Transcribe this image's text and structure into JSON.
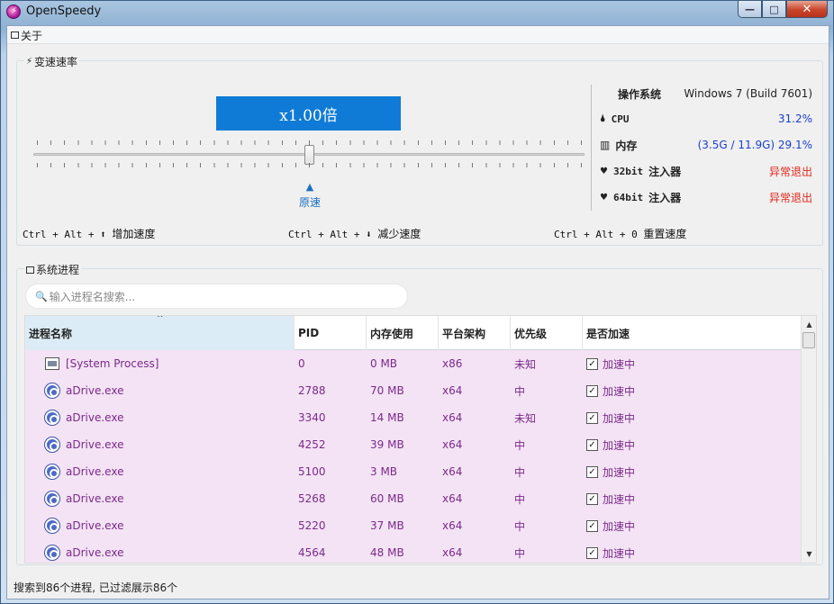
{
  "window": {
    "title": "OpenSpeedy",
    "app_icon_glyph": "⚡",
    "controls": {
      "minimize": "—",
      "maximize": "□",
      "close": "✕"
    }
  },
  "menu": {
    "about": "关于"
  },
  "speed": {
    "group_title": "变速速率",
    "group_icon": "⚡",
    "display": "x1.00倍",
    "multiplier": 1.0,
    "origin_arrow": "▲",
    "origin_label": "原速",
    "hotkeys": {
      "increase_keys": "Ctrl + Alt + ⬆",
      "increase_label": "增加速度",
      "decrease_keys": "Ctrl + Alt + ⬇",
      "decrease_label": "减少速度",
      "reset_keys": "Ctrl + Alt + 0",
      "reset_label": "重置速度"
    }
  },
  "system": {
    "os_label": "操作系统",
    "os_value": "Windows 7 (Build 7601)",
    "cpu_icon": "🌢",
    "cpu_label": "CPU",
    "cpu_value": "31.2%",
    "mem_icon": "▥",
    "mem_label": "内存",
    "mem_value": "(3.5G / 11.9G) 29.1%",
    "inj32_icon": "♥",
    "inj32_label_a": "32bit",
    "inj32_label_b": "注入器",
    "inj32_value": "异常退出",
    "inj64_icon": "♥",
    "inj64_label_a": "64bit",
    "inj64_label_b": "注入器",
    "inj64_value": "异常退出",
    "colors": {
      "value_blue": "#1a3fcc",
      "error_red": "#e0281b"
    }
  },
  "processes": {
    "group_title": "系统进程",
    "search_icon": "🔍",
    "search_placeholder": "输入进程名搜索...",
    "sort_arrow": "^",
    "columns": [
      "进程名称",
      "PID",
      "内存使用",
      "平台架构",
      "优先级",
      "是否加速"
    ],
    "check_glyph": "✓",
    "rows": [
      {
        "icon": "system",
        "name": "[System Process]",
        "pid": "0",
        "memory": "0 MB",
        "arch": "x86",
        "priority": "未知",
        "accel": "加速中"
      },
      {
        "icon": "adrive",
        "name": "aDrive.exe",
        "pid": "2788",
        "memory": "70 MB",
        "arch": "x64",
        "priority": "中",
        "accel": "加速中"
      },
      {
        "icon": "adrive",
        "name": "aDrive.exe",
        "pid": "3340",
        "memory": "14 MB",
        "arch": "x64",
        "priority": "未知",
        "accel": "加速中"
      },
      {
        "icon": "adrive",
        "name": "aDrive.exe",
        "pid": "4252",
        "memory": "39 MB",
        "arch": "x64",
        "priority": "中",
        "accel": "加速中"
      },
      {
        "icon": "adrive",
        "name": "aDrive.exe",
        "pid": "5100",
        "memory": "3 MB",
        "arch": "x64",
        "priority": "中",
        "accel": "加速中"
      },
      {
        "icon": "adrive",
        "name": "aDrive.exe",
        "pid": "5268",
        "memory": "60 MB",
        "arch": "x64",
        "priority": "中",
        "accel": "加速中"
      },
      {
        "icon": "adrive",
        "name": "aDrive.exe",
        "pid": "5220",
        "memory": "37 MB",
        "arch": "x64",
        "priority": "中",
        "accel": "加速中"
      },
      {
        "icon": "adrive",
        "name": "aDrive.exe",
        "pid": "4564",
        "memory": "48 MB",
        "arch": "x64",
        "priority": "中",
        "accel": "加速中"
      }
    ],
    "row_color": "#f3e3f4",
    "row_text_color": "#7b2a8a",
    "scroll_up": "▲",
    "scroll_down": "▼"
  },
  "status": {
    "text": "搜索到86个进程, 已过滤展示86个"
  }
}
